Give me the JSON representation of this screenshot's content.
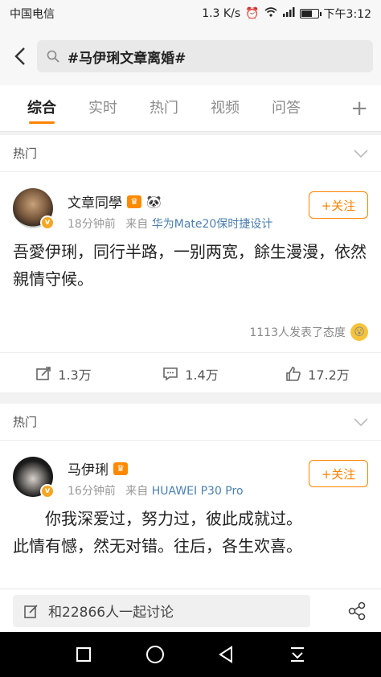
{
  "status_bar": {
    "carrier": "中国电信",
    "speed": "1.3 K/s",
    "time": "下午3:12",
    "battery_level": 0.7
  },
  "search": {
    "query": "#马伊琍文章离婚#"
  },
  "tabs": [
    {
      "label": "综合",
      "active": true
    },
    {
      "label": "实时",
      "active": false
    },
    {
      "label": "热门",
      "active": false
    },
    {
      "label": "视频",
      "active": false
    },
    {
      "label": "问答",
      "active": false
    }
  ],
  "tab_more_label": "+",
  "posts": [
    {
      "section_label": "热门",
      "username": "文章同學",
      "time": "18分钟前",
      "from_label": "来自",
      "source": "华为Mate20保时捷设计",
      "follow_label": "+关注",
      "text": "吾愛伊琍，同行半路，一别两宽，餘生漫漫，依然親情守候。",
      "reactions": "1113人发表了态度",
      "repost_count": "1.3万",
      "comment_count": "1.4万",
      "like_count": "17.2万"
    },
    {
      "section_label": "热门",
      "username": "马伊琍",
      "time": "16分钟前",
      "from_label": "来自",
      "source": "HUAWEI P30 Pro",
      "follow_label": "+关注",
      "text_line1": "你我深爱过，努力过，彼此成就过。",
      "text_rest": "此情有憾，然无对错。往后，各生欢喜。"
    }
  ],
  "compose": {
    "placeholder": "和22866人一起讨论"
  },
  "colors": {
    "accent": "#ff8200",
    "link": "#4a7fb0",
    "verified": "#f5a623"
  }
}
